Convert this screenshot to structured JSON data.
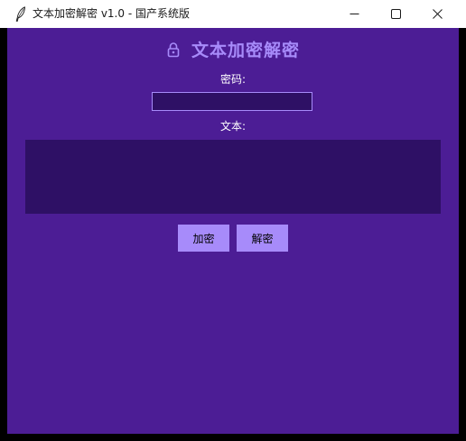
{
  "window": {
    "title": "文本加密解密  v1.0  -  国产系统版",
    "app_icon": "feather-icon",
    "controls": {
      "minimize_icon": "minimize-icon",
      "maximize_icon": "maximize-icon",
      "close_icon": "close-icon"
    }
  },
  "header": {
    "icon": "lock-icon",
    "title": "文本加密解密"
  },
  "form": {
    "password_label": "密码:",
    "password_value": "",
    "text_label": "文本:",
    "text_value": ""
  },
  "actions": {
    "encrypt_label": "加密",
    "decrypt_label": "解密"
  },
  "colors": {
    "background": "#4c1d95",
    "input_background": "#2e1065",
    "accent": "#a78bfa",
    "label_text": "#ffffff",
    "titlebar": "#ffffff"
  }
}
